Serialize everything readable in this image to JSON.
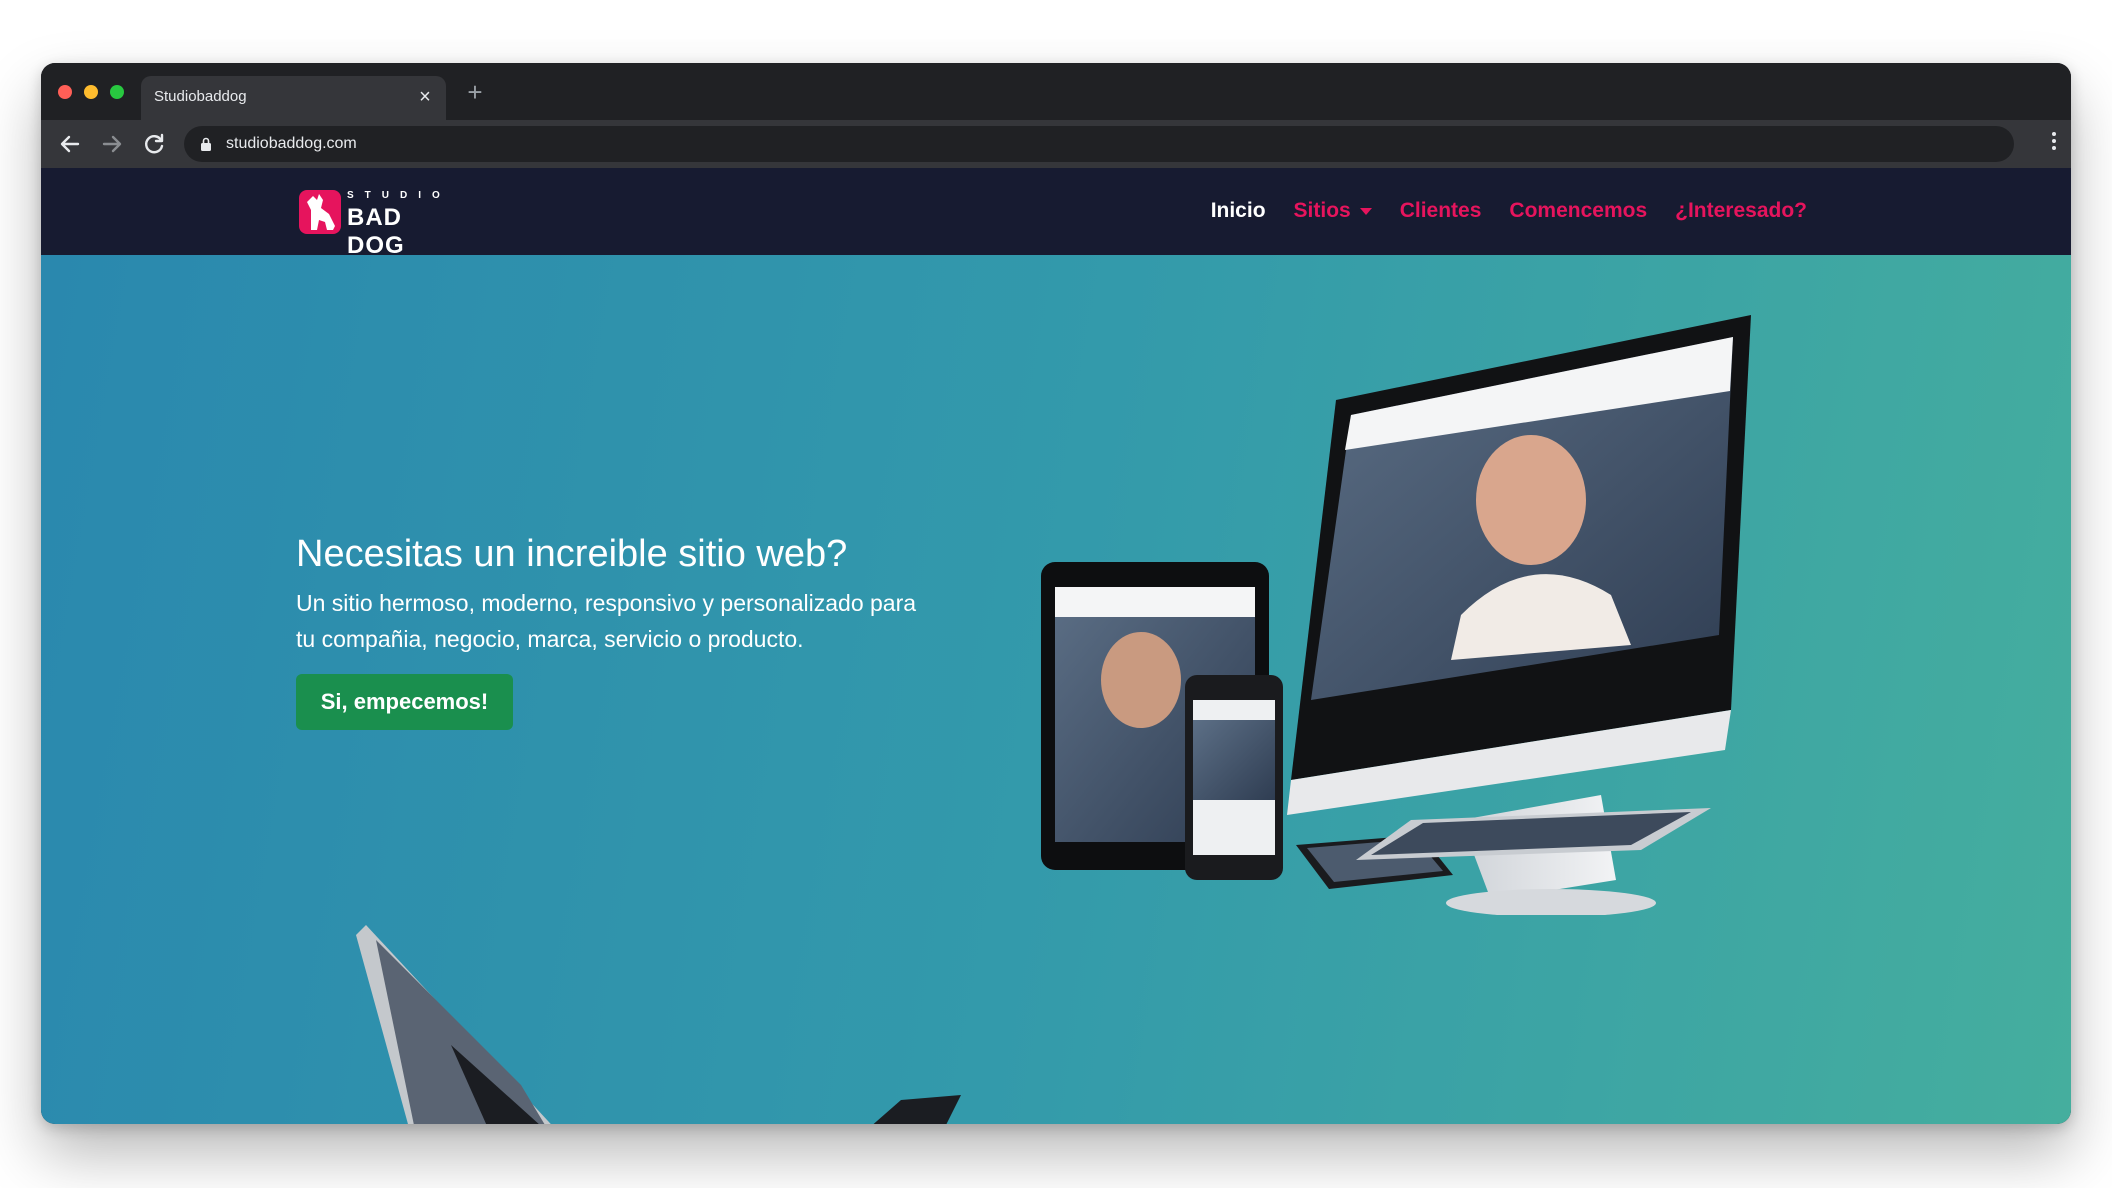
{
  "browser": {
    "tab_title": "Studiobaddog",
    "tab_close": "×",
    "new_tab": "+",
    "url": "studiobaddog.com"
  },
  "site": {
    "logo_top": "STUDIO",
    "logo_name": "BAD DOG",
    "nav": [
      {
        "label": "Inicio",
        "active": true
      },
      {
        "label": "Sitios",
        "dropdown": true
      },
      {
        "label": "Clientes"
      },
      {
        "label": "Comencemos"
      },
      {
        "label": "¿Interesado?"
      }
    ]
  },
  "hero": {
    "title": "Necesitas un increible sitio web?",
    "subtitle": "Un sitio hermoso, moderno, responsivo y personalizado para tu compañia, negocio, marca, servicio o producto.",
    "cta": "Si, empecemos!"
  },
  "colors": {
    "accent": "#e6145d",
    "nav_bg": "#171b31",
    "cta_bg": "#1a8f4e",
    "hero_from": "#2a88ae",
    "hero_to": "#45ae9e"
  },
  "icons": {
    "back": "arrow-left-icon",
    "forward": "arrow-right-icon",
    "reload": "reload-icon",
    "lock": "lock-icon",
    "menu": "kebab-menu-icon",
    "logo": "dog-logo-icon"
  }
}
